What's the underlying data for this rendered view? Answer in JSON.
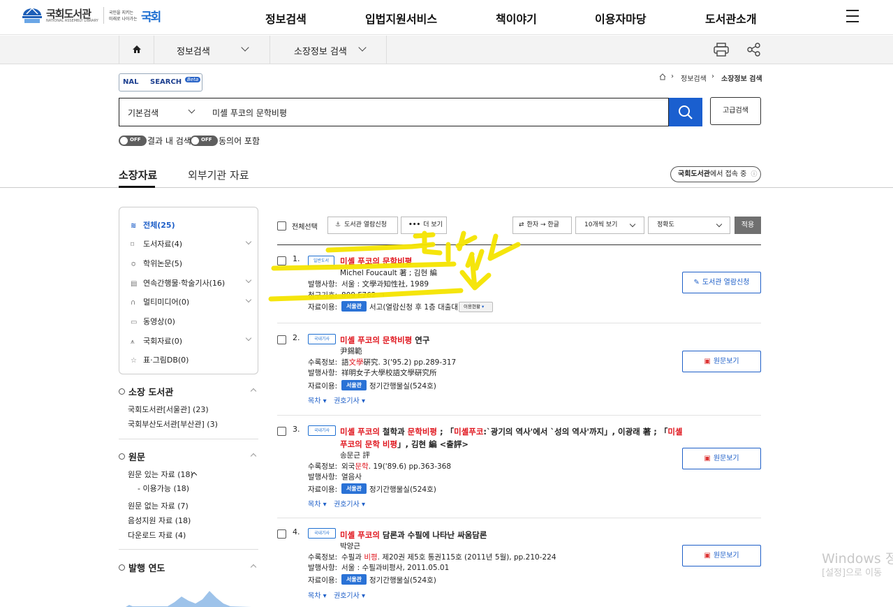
{
  "header": {
    "logo_title": "국회도서관",
    "logo_subtitle": "NATIONAL ASSEMBLY LIBRARY",
    "slogan_line1": "국민을 지키는",
    "slogan_line2": "미래로 나아가는",
    "slogan_mark": "국회",
    "nav": [
      "정보검색",
      "입법지원서비스",
      "책이야기",
      "이용자마당",
      "도서관소개"
    ]
  },
  "subnav": {
    "item1": "정보검색",
    "item2": "소장정보 검색"
  },
  "breadcrumb": [
    "정보검색",
    "소장정보 검색"
  ],
  "search": {
    "logo_text_left": "NAL",
    "logo_text_right": "SEARCH",
    "logo_beta": "Beta",
    "type": "기본검색",
    "query": "미셸 푸코의 문학비평",
    "advanced_label": "고급검색",
    "toggle_off": "OFF",
    "toggle1_label": "결과 내 검색",
    "toggle2_label": "동의어 포함"
  },
  "tabs": {
    "holdings": "소장자료",
    "external": "외부기관 자료",
    "connection_org": "국회도서관",
    "connection_suffix": "에서 접속 중"
  },
  "facets": [
    {
      "label": "전체(25)",
      "icon": "layers-icon"
    },
    {
      "label": "도서자료(4)",
      "icon": "bookmark-icon"
    },
    {
      "label": "학위논문(5)",
      "icon": "graduation-cap-icon"
    },
    {
      "label": "연속간행물·학술기사(16)",
      "icon": "newspaper-icon"
    },
    {
      "label": "멀티미디어(0)",
      "icon": "headphones-icon"
    },
    {
      "label": "동영상(0)",
      "icon": "video-icon"
    },
    {
      "label": "국회자료(0)",
      "icon": "building-icon"
    },
    {
      "label": "표·그림DB(0)",
      "icon": "star-icon"
    }
  ],
  "sidebar": {
    "libraries_title": "소장 도서관",
    "libraries": [
      "국회도서관[서울관] (23)",
      "국회부산도서관[부산관] (3)"
    ],
    "fulltext_title": "원문",
    "fulltext_items": [
      "원문 있는 자료 (18)",
      "- 이용가능 (18)",
      "원문 없는 자료 (7)",
      "음성지원 자료 (18)",
      "다운로드 자료 (4)"
    ],
    "year_title": "발행 연도"
  },
  "toolbar": {
    "select_all": "전체선택",
    "request_btn": "도서관 열람신청",
    "more_btn": "더 보기",
    "hanja_btn": "한자 → 한글",
    "per_page": "10개씩 보기",
    "sort": "정확도",
    "apply": "적용"
  },
  "results": [
    {
      "num": "1.",
      "badge": "일반도서",
      "title_hl": "미셸 푸코의 문학비평",
      "author": "Michel Foucault 著 ; 김현 編",
      "l1": "발행사항:",
      "v1": "서울 : 文學과知性社, 1989",
      "l2": "청구기호:",
      "v2": "809 F762 ㄱ",
      "l3": "자료이용:",
      "loc": "서울관",
      "v3": "서고(열람신청 후 1층 대출대)",
      "status": "이용현황",
      "button": "도서관 열람신청"
    },
    {
      "num": "2.",
      "badge": "국내기사",
      "title_hl": "미셸 푸코의 문학비평",
      "title_rest": " 연구",
      "author": "尹錫範",
      "l1": "수록정보:",
      "v1_a": "語",
      "v1_b": "文學",
      "v1_c": "硏究. 3('95.2) pp.289-317",
      "l2": "발행사항:",
      "v2": "祥明女子大學校語文學硏究所",
      "l3": "자료이용:",
      "loc": "서울관",
      "v3": "정기간행물실(524호)",
      "toc": "목차",
      "vol": "권호기사",
      "button": "원문보기"
    },
    {
      "num": "3.",
      "badge": "국내기사",
      "t1": "미셸 푸코의",
      "t2": " 철학과 ",
      "t3": "문학비평",
      "t4": " ; 「",
      "t5": "미셸푸코",
      "t6": ":`광기의 역사'에서 `성의 역사'까지」, 이광래 著 ; 「",
      "t7": "미셸",
      "t8": "푸코의 문학 비평",
      "t9": "」, 김현 編 <출評>",
      "author": "송문근 評",
      "l1": "수록정보:",
      "v1_a": "외국",
      "v1_b": "문학",
      "v1_c": ". 19('89.6) pp.363-368",
      "l2": "발행사항:",
      "v2": "열음사",
      "l3": "자료이용:",
      "loc": "서울관",
      "v3": "정기간행물실(524호)",
      "toc": "목차",
      "vol": "권호기사",
      "button": "원문보기"
    },
    {
      "num": "4.",
      "badge": "국내기사",
      "title_hl": "미셸 푸코의",
      "title_rest": " 담론과 수필에 나타난 싸움담론",
      "author": "박양근",
      "l1": "수록정보:",
      "v1_a": "수필과 ",
      "v1_b": "비평",
      "v1_c": ". 제20권 제5호 통권115호 (2011년 5월), pp.210-224",
      "l2": "발행사항:",
      "v2": "서울 : 수필과비평사, 2011.05.01",
      "l3": "자료이용:",
      "loc": "서울관",
      "v3": "정기간행물실(524호)",
      "toc": "목차",
      "vol": "권호기사",
      "button": "원문보기"
    }
  ],
  "annotation": "click",
  "watermark": {
    "line1": "Windows 정",
    "line2": "[설정]으로 이동"
  },
  "colors": {
    "accent": "#1a5fcf",
    "highlight": "#e0161e",
    "marker": "#f5e400"
  }
}
